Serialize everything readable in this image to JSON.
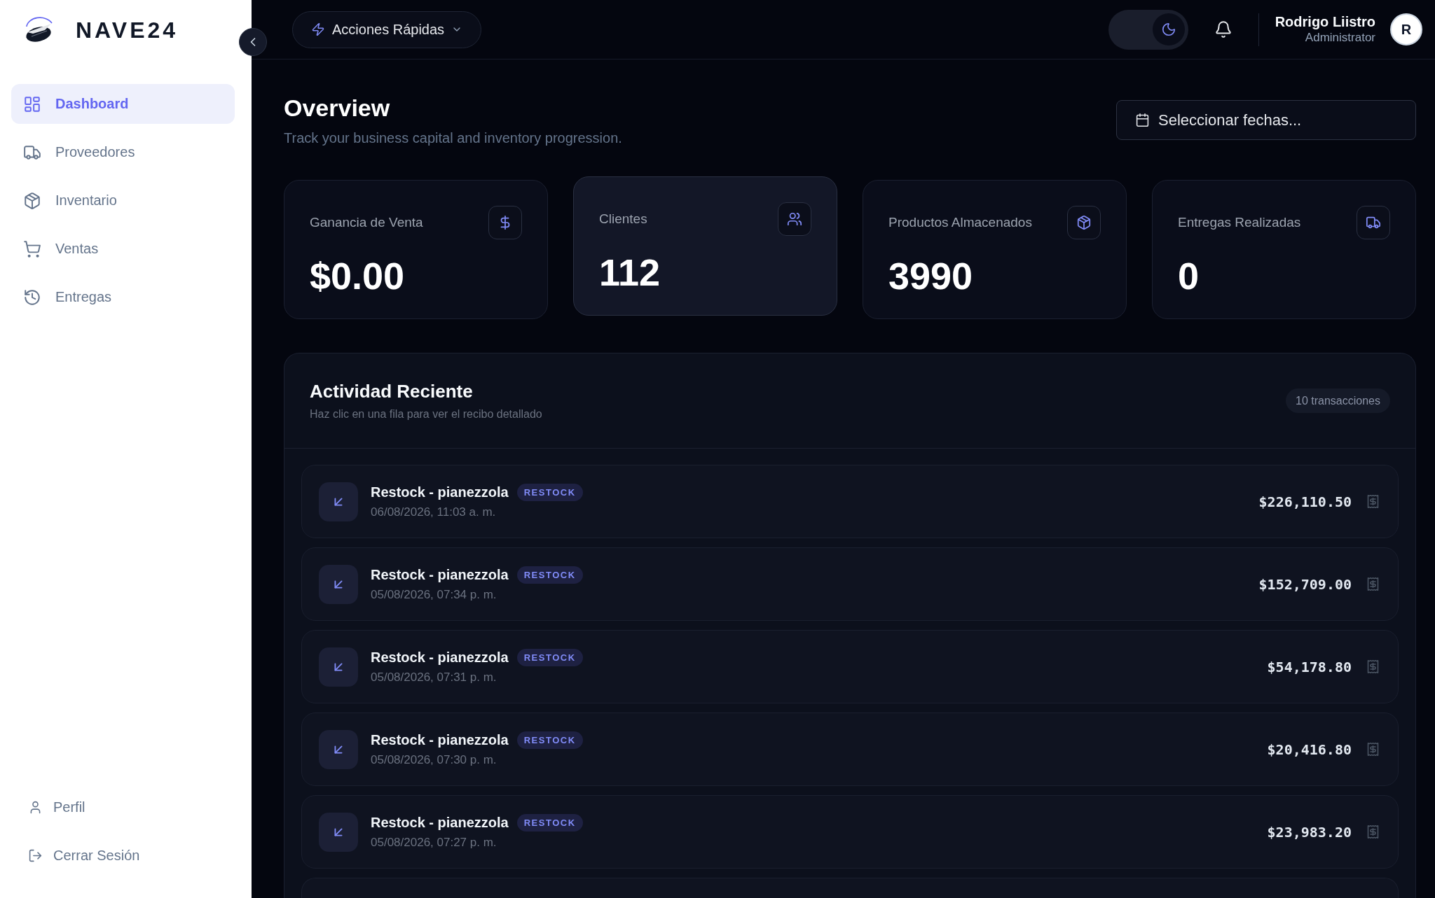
{
  "sidebar": {
    "brand": "NAVE24",
    "nav_items": [
      {
        "label": "Dashboard",
        "selected": true
      },
      {
        "label": "Proveedores",
        "selected": false
      },
      {
        "label": "Inventario",
        "selected": false
      },
      {
        "label": "Ventas",
        "selected": false
      },
      {
        "label": "Entregas",
        "selected": false
      }
    ],
    "footer_items": [
      "Perfil",
      "Cerrar Sesión"
    ]
  },
  "topbar": {
    "quick_actions": "Acciones Rápidas",
    "theme_toggle": {
      "on": true
    },
    "user": {
      "name": "Rodrigo Liistro",
      "role": "Administrator",
      "initial": "R"
    }
  },
  "overview": {
    "title": "Overview",
    "subtitle": "Track your business capital and inventory progression.",
    "date_button": "Seleccionar fechas..."
  },
  "stats": [
    {
      "label": "Ganancia de Venta",
      "value": "$0.00",
      "highlighted": false
    },
    {
      "label": "Clientes",
      "value": "112",
      "highlighted": true
    },
    {
      "label": "Productos Almacenados",
      "value": "3990",
      "highlighted": false
    },
    {
      "label": "Entregas Realizadas",
      "value": "0",
      "highlighted": false
    }
  ],
  "activity": {
    "title": "Actividad Reciente",
    "subtitle": "Haz clic en una fila para ver el recibo detallado",
    "count": "10 transacciones",
    "rows": [
      {
        "title": "Restock - pianezzola",
        "tag": "RESTOCK",
        "date": "06/08/2026, 11:03 a. m.",
        "amount": "$226,110.50"
      },
      {
        "title": "Restock - pianezzola",
        "tag": "RESTOCK",
        "date": "05/08/2026, 07:34 p. m.",
        "amount": "$152,709.00"
      },
      {
        "title": "Restock - pianezzola",
        "tag": "RESTOCK",
        "date": "05/08/2026, 07:31 p. m.",
        "amount": "$54,178.80"
      },
      {
        "title": "Restock - pianezzola",
        "tag": "RESTOCK",
        "date": "05/08/2026, 07:30 p. m.",
        "amount": "$20,416.80"
      },
      {
        "title": "Restock - pianezzola",
        "tag": "RESTOCK",
        "date": "05/08/2026, 07:27 p. m.",
        "amount": "$23,983.20"
      }
    ]
  }
}
